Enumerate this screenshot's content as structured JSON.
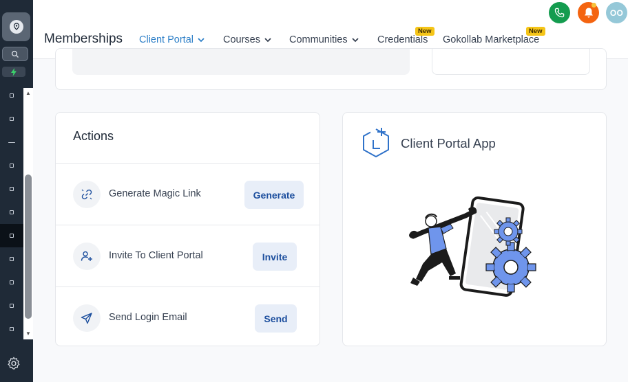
{
  "colors": {
    "sidebar_bg": "#1f2a37",
    "accent": "#2f80c8",
    "phone_green": "#149c4f",
    "bell_orange": "#f46410",
    "avatar_teal": "#95c8d8",
    "new_badge": "#f5c518",
    "button_bg": "#e8eef8",
    "button_text": "#1d4f9e",
    "illustration_blue": "#6f95ec"
  },
  "sidebar": {
    "logo_icon": "location-pin-icon",
    "search_icon": "search-icon",
    "quick_action_icon": "lightning-icon",
    "settings_icon": "gear-icon"
  },
  "header": {
    "title": "Memberships",
    "tabs": [
      {
        "label": "Client Portal",
        "has_dropdown": true,
        "active": true
      },
      {
        "label": "Courses",
        "has_dropdown": true
      },
      {
        "label": "Communities",
        "has_dropdown": true
      },
      {
        "label": "Credentials",
        "badge": "New"
      },
      {
        "label": "Gokollab Marketplace",
        "badge": "New"
      }
    ],
    "avatar_initials": "OO"
  },
  "actions": {
    "title": "Actions",
    "rows": [
      {
        "label": "Generate Magic Link",
        "button": "Generate",
        "icon": "magic-link-icon"
      },
      {
        "label": "Invite To Client Portal",
        "button": "Invite",
        "icon": "user-plus-icon"
      },
      {
        "label": "Send Login Email",
        "button": "Send",
        "icon": "send-icon"
      }
    ]
  },
  "app_card": {
    "title": "Client Portal App",
    "icon": "app-add-icon"
  }
}
